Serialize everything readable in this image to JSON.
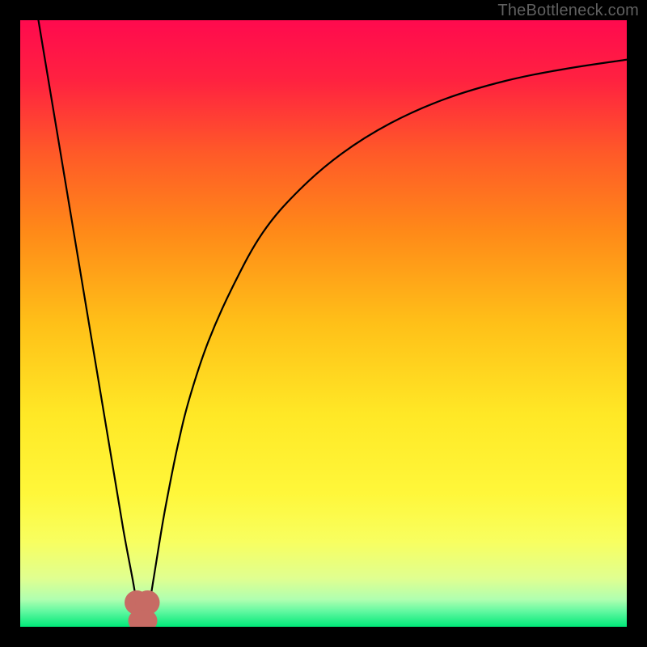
{
  "watermark": "TheBottleneck.com",
  "gradient": {
    "stops": [
      {
        "offset": 0.0,
        "color": "#ff0a4e"
      },
      {
        "offset": 0.1,
        "color": "#ff2240"
      },
      {
        "offset": 0.22,
        "color": "#ff5a28"
      },
      {
        "offset": 0.35,
        "color": "#ff8a18"
      },
      {
        "offset": 0.5,
        "color": "#ffc018"
      },
      {
        "offset": 0.65,
        "color": "#ffe826"
      },
      {
        "offset": 0.78,
        "color": "#fff73a"
      },
      {
        "offset": 0.86,
        "color": "#f8ff60"
      },
      {
        "offset": 0.92,
        "color": "#e0ff90"
      },
      {
        "offset": 0.955,
        "color": "#b0ffb0"
      },
      {
        "offset": 0.975,
        "color": "#60f8a0"
      },
      {
        "offset": 1.0,
        "color": "#00e878"
      }
    ]
  },
  "chart_data": {
    "type": "line",
    "title": "",
    "xlabel": "",
    "ylabel": "",
    "xlim": [
      0,
      100
    ],
    "ylim": [
      0,
      100
    ],
    "series": [
      {
        "name": "curve",
        "x": [
          3,
          5,
          7,
          9,
          11,
          13,
          15,
          17,
          18.5,
          19.2,
          19.7,
          20.0,
          20.5,
          21.3,
          22.0,
          22.8,
          24,
          26,
          28,
          31,
          35,
          40,
          46,
          53,
          61,
          70,
          80,
          90,
          100
        ],
        "values": [
          100,
          88,
          76,
          64,
          52,
          40,
          28,
          16,
          8,
          4,
          1.5,
          0,
          1.5,
          4,
          8,
          13,
          20,
          30,
          38,
          47,
          56,
          65,
          72,
          78,
          83,
          87,
          90,
          92,
          93.5
        ]
      }
    ],
    "markers": [
      {
        "name": "min-left",
        "x": 19.2,
        "y": 4,
        "color": "#c76b64",
        "r": 1.2
      },
      {
        "name": "min-right",
        "x": 21.0,
        "y": 4,
        "color": "#c76b64",
        "r": 1.2
      },
      {
        "name": "min-bar-1",
        "x": 19.6,
        "y": 1.0,
        "color": "#c76b64",
        "r": 1.0
      },
      {
        "name": "min-bar-2",
        "x": 20.2,
        "y": 1.0,
        "color": "#c76b64",
        "r": 1.0
      },
      {
        "name": "min-bar-3",
        "x": 20.8,
        "y": 1.0,
        "color": "#c76b64",
        "r": 1.0
      }
    ]
  }
}
